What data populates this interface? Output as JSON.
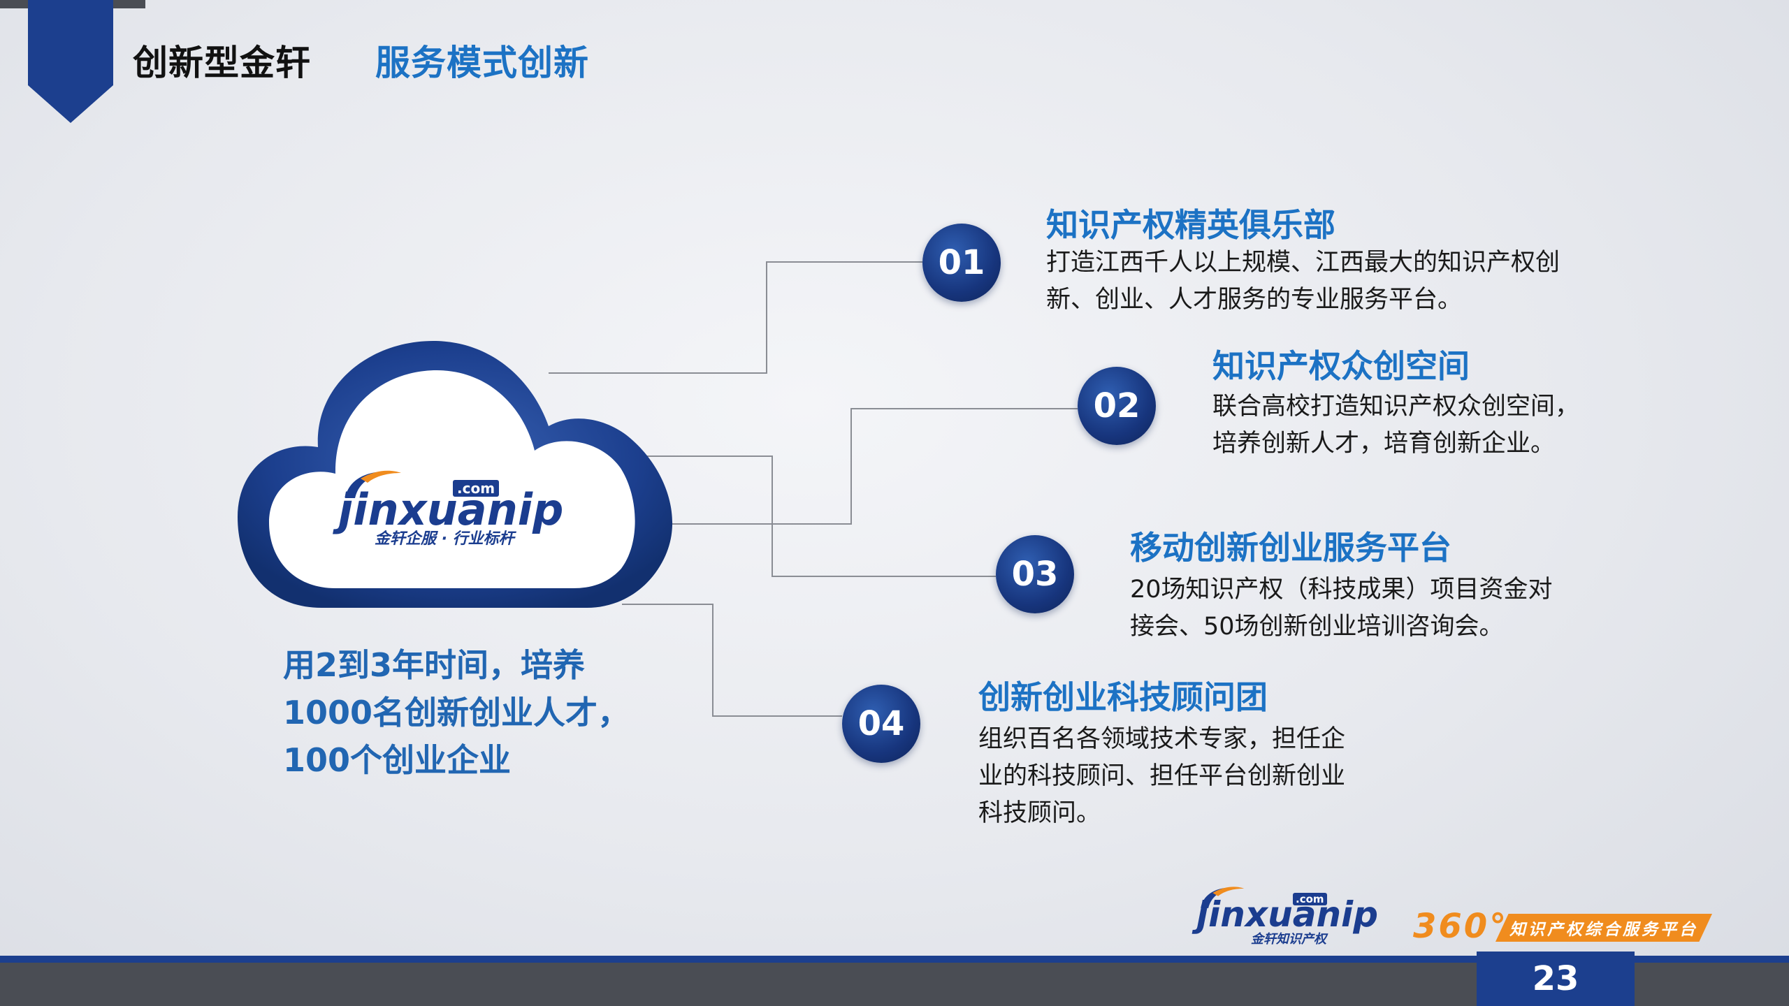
{
  "header": {
    "section_title": "创新型金轩",
    "page_subtitle": "服务模式创新"
  },
  "logo": {
    "wordmark": "jinxuanip",
    "domain_badge": ".com",
    "tagline": "金轩企服 · 行业标杆"
  },
  "goal": {
    "lines": [
      "用2到3年时间，培养",
      "1000名创新创业人才，",
      "100个创业企业"
    ]
  },
  "items": [
    {
      "number": "01",
      "title": "知识产权精英俱乐部",
      "desc": [
        "打造江西千人以上规模、江西最大的知识产权创",
        "新、创业、人才服务的专业服务平台。"
      ]
    },
    {
      "number": "02",
      "title": "知识产权众创空间",
      "desc": [
        "联合高校打造知识产权众创空间，",
        "培养创新人才，培育创新企业。"
      ]
    },
    {
      "number": "03",
      "title": "移动创新创业服务平台",
      "desc": [
        "20场知识产权（科技成果）项目资金对",
        "接会、50场创新创业培训咨询会。"
      ]
    },
    {
      "number": "04",
      "title": "创新创业科技顾问团",
      "desc": [
        "组织百名各领域技术专家，担任企",
        "业的科技顾问、担任平台创新创业",
        "科技顾问。"
      ]
    }
  ],
  "footer": {
    "logo_wordmark": "jinxuanip",
    "logo_domain": ".com",
    "logo_caption": "金轩知识产权",
    "badge": "360°",
    "slogan": "知识产权综合服务平台",
    "page_number": "23"
  },
  "colors": {
    "navy": "#1c3f8e",
    "blue_text": "#1c72c4",
    "orange": "#f08c1e",
    "dark_bar": "#4a4d54"
  }
}
